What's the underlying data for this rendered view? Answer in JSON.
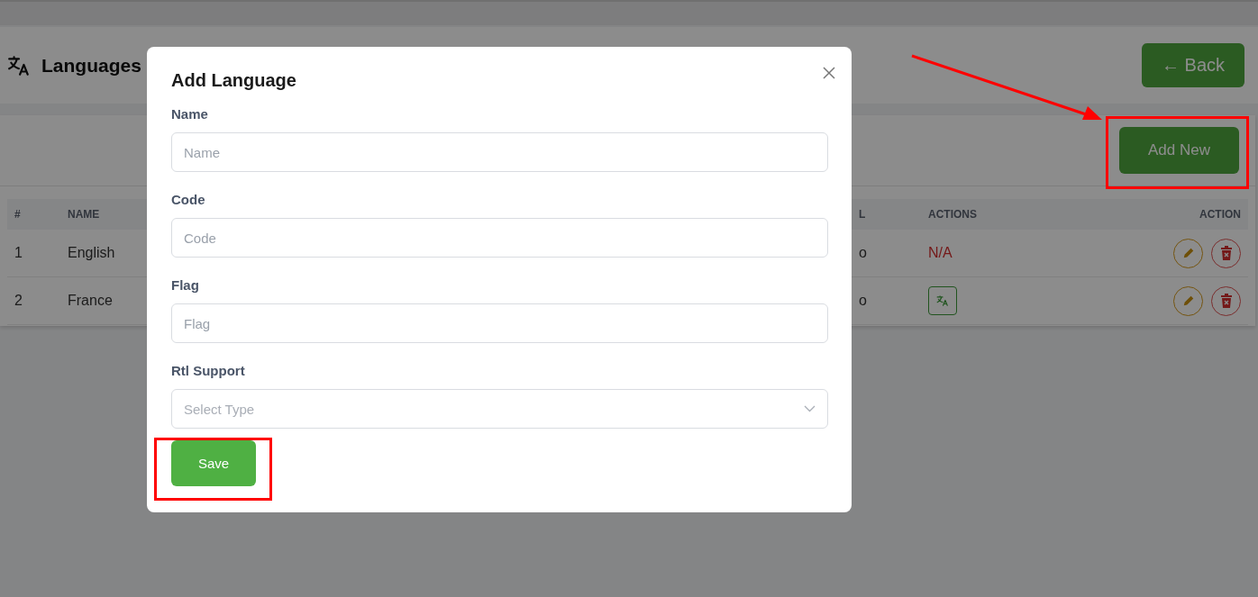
{
  "header": {
    "title": "Languages",
    "back_button": "← Back"
  },
  "toolbar": {
    "add_button": "Add New"
  },
  "table": {
    "columns": [
      "#",
      "NAME",
      "L",
      "ACTIONS",
      "ACTION"
    ],
    "rows": [
      {
        "cells": [
          "1",
          "English",
          "o"
        ],
        "translation": {
          "kind": "text",
          "text": "N/A"
        }
      },
      {
        "cells": [
          "2",
          "France",
          "o"
        ],
        "translation": {
          "kind": "button"
        }
      }
    ]
  },
  "modal": {
    "title": "Add Language",
    "fields": [
      {
        "label": "Name",
        "kind": "input",
        "placeholder": "Name"
      },
      {
        "label": "Code",
        "kind": "input",
        "placeholder": "Code"
      },
      {
        "label": "Flag",
        "kind": "input",
        "placeholder": "Flag"
      },
      {
        "label": "Rtl Support",
        "kind": "select",
        "placeholder": "Select Type"
      }
    ],
    "submit": "Save"
  }
}
